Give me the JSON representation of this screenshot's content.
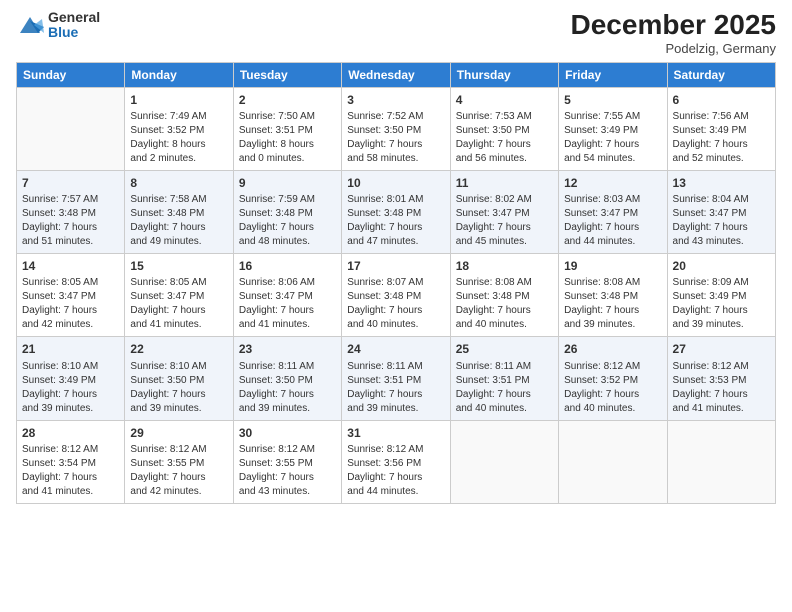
{
  "logo": {
    "general": "General",
    "blue": "Blue"
  },
  "title": "December 2025",
  "subtitle": "Podelzig, Germany",
  "days_of_week": [
    "Sunday",
    "Monday",
    "Tuesday",
    "Wednesday",
    "Thursday",
    "Friday",
    "Saturday"
  ],
  "weeks": [
    [
      {
        "day": "",
        "info": ""
      },
      {
        "day": "1",
        "info": "Sunrise: 7:49 AM\nSunset: 3:52 PM\nDaylight: 8 hours\nand 2 minutes."
      },
      {
        "day": "2",
        "info": "Sunrise: 7:50 AM\nSunset: 3:51 PM\nDaylight: 8 hours\nand 0 minutes."
      },
      {
        "day": "3",
        "info": "Sunrise: 7:52 AM\nSunset: 3:50 PM\nDaylight: 7 hours\nand 58 minutes."
      },
      {
        "day": "4",
        "info": "Sunrise: 7:53 AM\nSunset: 3:50 PM\nDaylight: 7 hours\nand 56 minutes."
      },
      {
        "day": "5",
        "info": "Sunrise: 7:55 AM\nSunset: 3:49 PM\nDaylight: 7 hours\nand 54 minutes."
      },
      {
        "day": "6",
        "info": "Sunrise: 7:56 AM\nSunset: 3:49 PM\nDaylight: 7 hours\nand 52 minutes."
      }
    ],
    [
      {
        "day": "7",
        "info": "Sunrise: 7:57 AM\nSunset: 3:48 PM\nDaylight: 7 hours\nand 51 minutes."
      },
      {
        "day": "8",
        "info": "Sunrise: 7:58 AM\nSunset: 3:48 PM\nDaylight: 7 hours\nand 49 minutes."
      },
      {
        "day": "9",
        "info": "Sunrise: 7:59 AM\nSunset: 3:48 PM\nDaylight: 7 hours\nand 48 minutes."
      },
      {
        "day": "10",
        "info": "Sunrise: 8:01 AM\nSunset: 3:48 PM\nDaylight: 7 hours\nand 47 minutes."
      },
      {
        "day": "11",
        "info": "Sunrise: 8:02 AM\nSunset: 3:47 PM\nDaylight: 7 hours\nand 45 minutes."
      },
      {
        "day": "12",
        "info": "Sunrise: 8:03 AM\nSunset: 3:47 PM\nDaylight: 7 hours\nand 44 minutes."
      },
      {
        "day": "13",
        "info": "Sunrise: 8:04 AM\nSunset: 3:47 PM\nDaylight: 7 hours\nand 43 minutes."
      }
    ],
    [
      {
        "day": "14",
        "info": "Sunrise: 8:05 AM\nSunset: 3:47 PM\nDaylight: 7 hours\nand 42 minutes."
      },
      {
        "day": "15",
        "info": "Sunrise: 8:05 AM\nSunset: 3:47 PM\nDaylight: 7 hours\nand 41 minutes."
      },
      {
        "day": "16",
        "info": "Sunrise: 8:06 AM\nSunset: 3:47 PM\nDaylight: 7 hours\nand 41 minutes."
      },
      {
        "day": "17",
        "info": "Sunrise: 8:07 AM\nSunset: 3:48 PM\nDaylight: 7 hours\nand 40 minutes."
      },
      {
        "day": "18",
        "info": "Sunrise: 8:08 AM\nSunset: 3:48 PM\nDaylight: 7 hours\nand 40 minutes."
      },
      {
        "day": "19",
        "info": "Sunrise: 8:08 AM\nSunset: 3:48 PM\nDaylight: 7 hours\nand 39 minutes."
      },
      {
        "day": "20",
        "info": "Sunrise: 8:09 AM\nSunset: 3:49 PM\nDaylight: 7 hours\nand 39 minutes."
      }
    ],
    [
      {
        "day": "21",
        "info": "Sunrise: 8:10 AM\nSunset: 3:49 PM\nDaylight: 7 hours\nand 39 minutes."
      },
      {
        "day": "22",
        "info": "Sunrise: 8:10 AM\nSunset: 3:50 PM\nDaylight: 7 hours\nand 39 minutes."
      },
      {
        "day": "23",
        "info": "Sunrise: 8:11 AM\nSunset: 3:50 PM\nDaylight: 7 hours\nand 39 minutes."
      },
      {
        "day": "24",
        "info": "Sunrise: 8:11 AM\nSunset: 3:51 PM\nDaylight: 7 hours\nand 39 minutes."
      },
      {
        "day": "25",
        "info": "Sunrise: 8:11 AM\nSunset: 3:51 PM\nDaylight: 7 hours\nand 40 minutes."
      },
      {
        "day": "26",
        "info": "Sunrise: 8:12 AM\nSunset: 3:52 PM\nDaylight: 7 hours\nand 40 minutes."
      },
      {
        "day": "27",
        "info": "Sunrise: 8:12 AM\nSunset: 3:53 PM\nDaylight: 7 hours\nand 41 minutes."
      }
    ],
    [
      {
        "day": "28",
        "info": "Sunrise: 8:12 AM\nSunset: 3:54 PM\nDaylight: 7 hours\nand 41 minutes."
      },
      {
        "day": "29",
        "info": "Sunrise: 8:12 AM\nSunset: 3:55 PM\nDaylight: 7 hours\nand 42 minutes."
      },
      {
        "day": "30",
        "info": "Sunrise: 8:12 AM\nSunset: 3:55 PM\nDaylight: 7 hours\nand 43 minutes."
      },
      {
        "day": "31",
        "info": "Sunrise: 8:12 AM\nSunset: 3:56 PM\nDaylight: 7 hours\nand 44 minutes."
      },
      {
        "day": "",
        "info": ""
      },
      {
        "day": "",
        "info": ""
      },
      {
        "day": "",
        "info": ""
      }
    ]
  ]
}
